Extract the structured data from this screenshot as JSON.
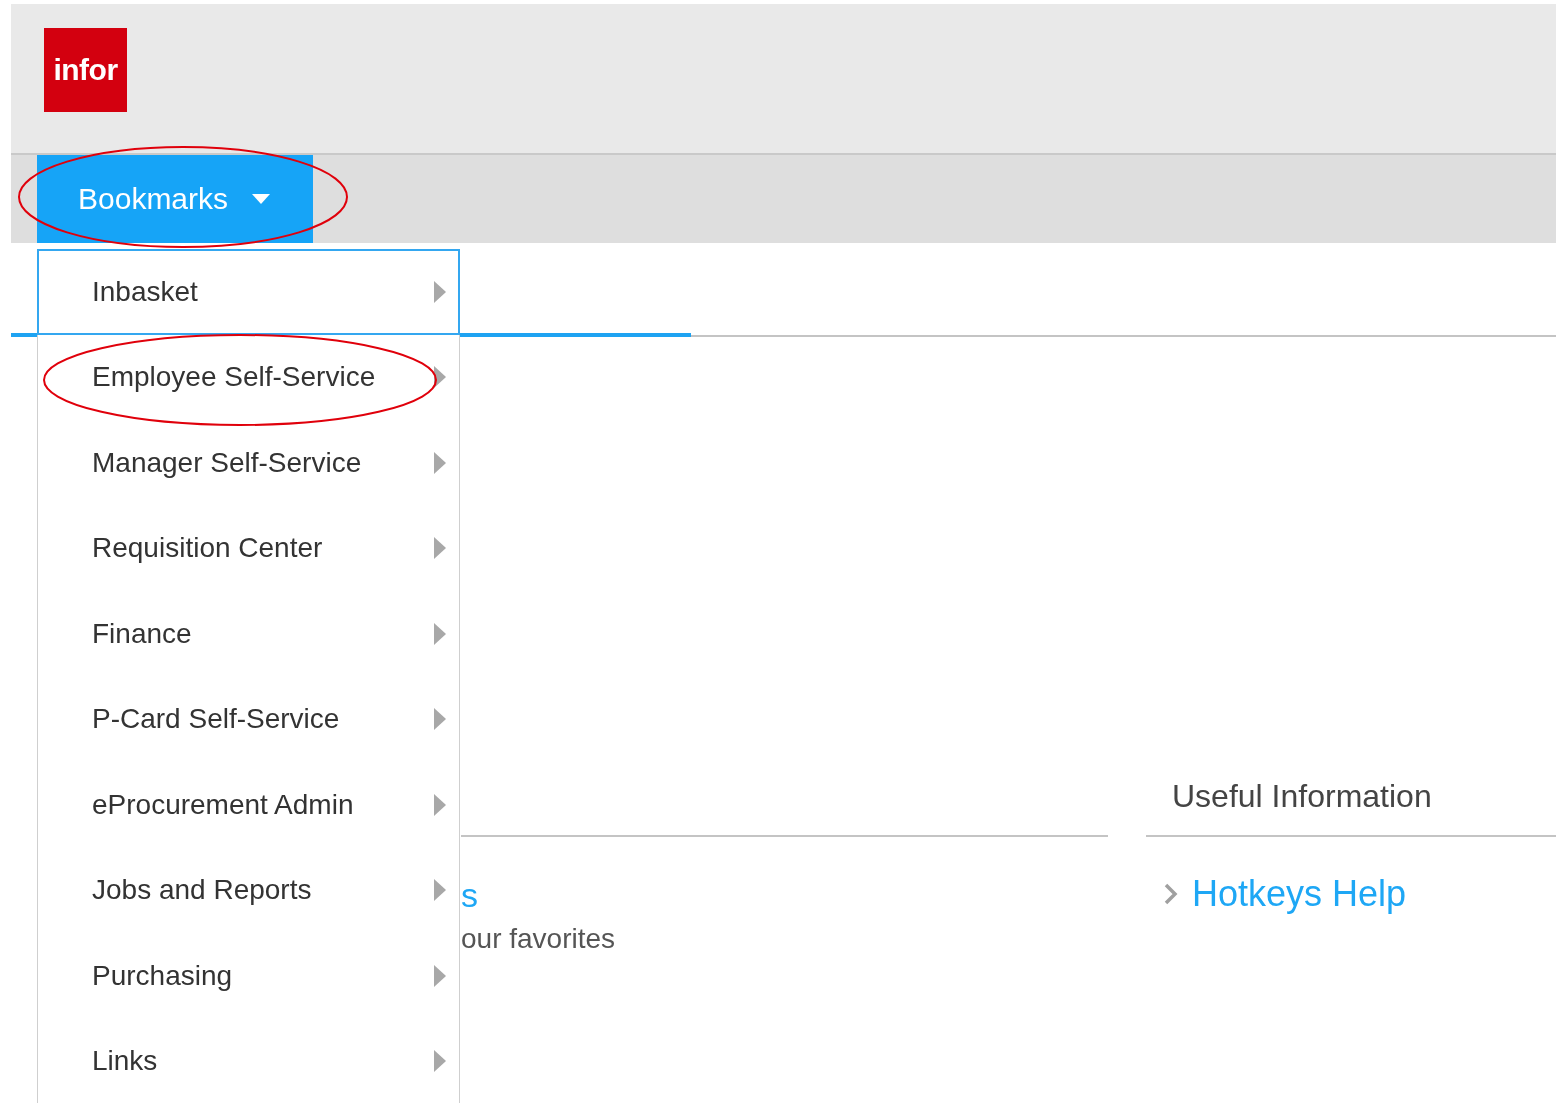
{
  "header": {
    "logo": "infor"
  },
  "nav": {
    "bookmarks_button": {
      "label": "Bookmarks",
      "highlighted": true
    }
  },
  "bookmarks_menu": {
    "items": [
      {
        "label": "Inbasket",
        "selected": true,
        "highlighted": false
      },
      {
        "label": "Employee Self-Service",
        "selected": false,
        "highlighted": true
      },
      {
        "label": "Manager Self-Service",
        "selected": false,
        "highlighted": false
      },
      {
        "label": "Requisition Center",
        "selected": false,
        "highlighted": false
      },
      {
        "label": "Finance",
        "selected": false,
        "highlighted": false
      },
      {
        "label": "P-Card Self-Service",
        "selected": false,
        "highlighted": false
      },
      {
        "label": "eProcurement Admin",
        "selected": false,
        "highlighted": false
      },
      {
        "label": "Jobs and Reports",
        "selected": false,
        "highlighted": false
      },
      {
        "label": "Purchasing",
        "selected": false,
        "highlighted": false
      },
      {
        "label": "Links",
        "selected": false,
        "highlighted": false
      }
    ]
  },
  "favorites_section": {
    "link": "s",
    "description": "our favorites"
  },
  "useful_information": {
    "heading": "Useful Information",
    "links": [
      "Hotkeys Help"
    ]
  }
}
